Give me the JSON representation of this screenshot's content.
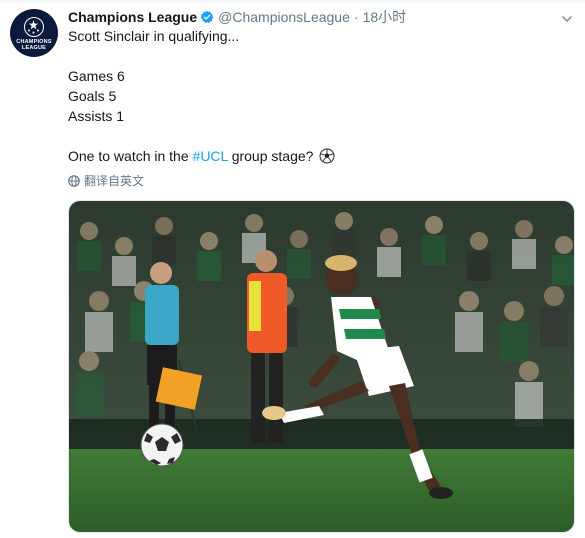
{
  "tweet": {
    "display_name": "Champions League",
    "handle": "@ChampionsLeague",
    "separator": "·",
    "time": "18小时",
    "lines": [
      "Scott Sinclair in qualifying...",
      "Games 6",
      "Goals 5",
      "Assists 1"
    ],
    "last_line": {
      "before": "One to watch in the ",
      "hashtag": "#UCL",
      "after": " group stage? "
    },
    "translate_label": "翻译自英文"
  },
  "avatar": {
    "logo_line1": "CHAMPIONS",
    "logo_line2": "LEAGUE"
  },
  "icons": {
    "verified": "verified-badge-icon",
    "caret": "chevron-down-icon",
    "globe": "globe-icon",
    "emoji": "soccer-ball-emoji"
  },
  "colors": {
    "text": "#14171a",
    "secondary": "#657786",
    "link": "#1da1f2",
    "avatar_bg": "#0b1a3c"
  }
}
